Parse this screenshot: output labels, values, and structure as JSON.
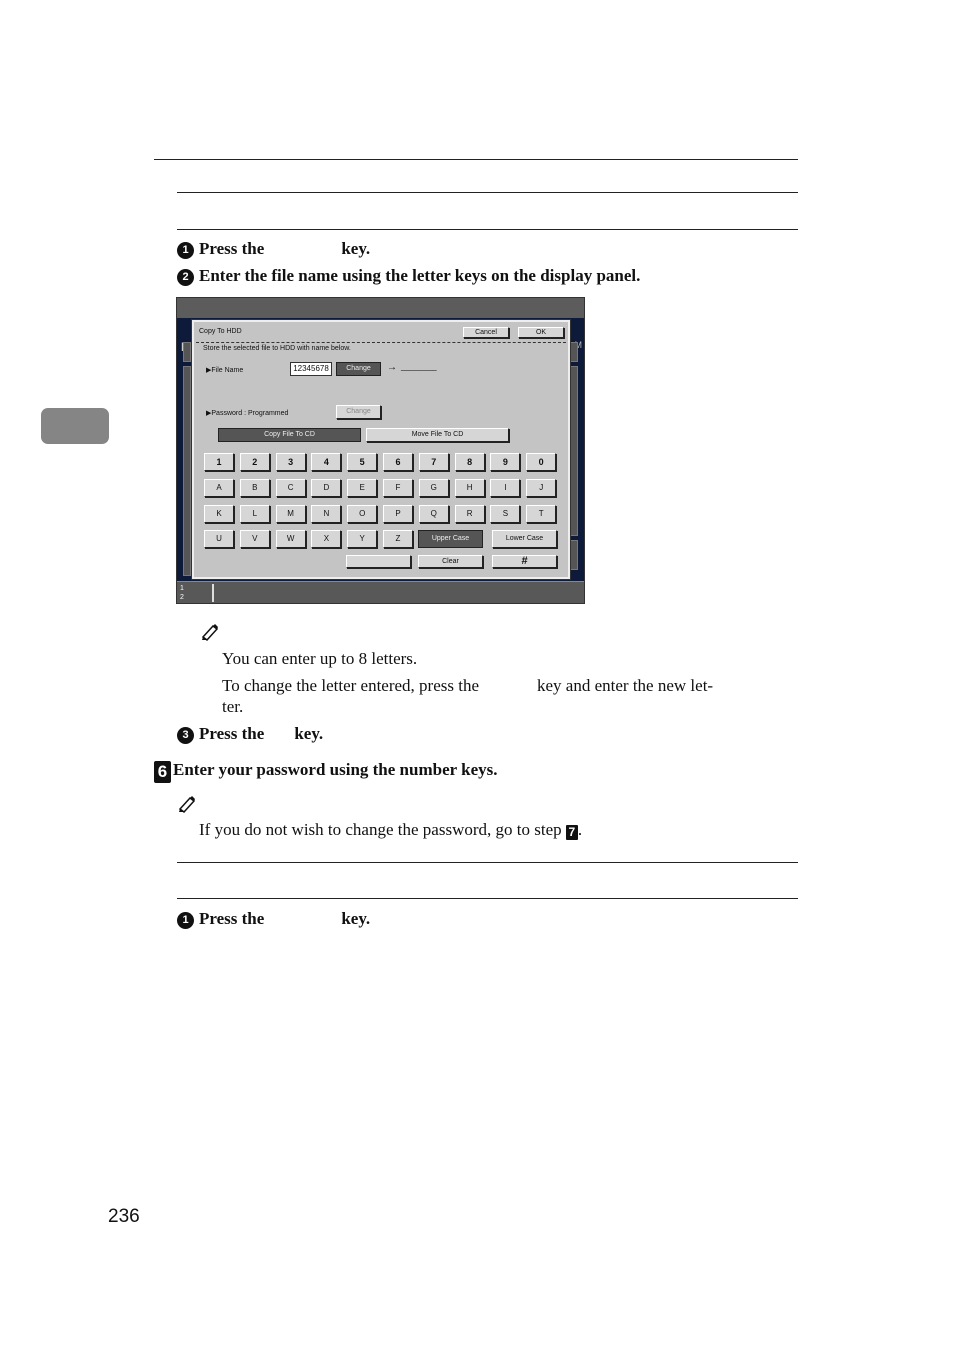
{
  "steps_top": {
    "step1": {
      "num": "1",
      "text_before": "Press the",
      "text_after": "key."
    },
    "step2": {
      "num": "2",
      "text": "Enter the file name using the letter keys on the display panel."
    }
  },
  "screen": {
    "bg_letter": "D",
    "bg_right_label": "M",
    "tray": {
      "line1": "1",
      "line2": "2"
    },
    "dialog": {
      "title": "Copy To HDD",
      "cancel_label": "Cancel",
      "ok_label": "OK",
      "description": "Store the selected file to HDD with name below.",
      "file_name_label": "▶File Name",
      "file_name_value": "12345678",
      "change_label": "Change",
      "arrow": "→",
      "new_name": "________",
      "password_label": "▶Password : Programmed",
      "password_change_label": "Change",
      "copy_to_cd_label": "Copy File To CD",
      "move_to_cd_label": "Move File To CD",
      "number_keys": [
        "1",
        "2",
        "3",
        "4",
        "5",
        "6",
        "7",
        "8",
        "9",
        "0"
      ],
      "letter_row1": [
        "A",
        "B",
        "C",
        "D",
        "E",
        "F",
        "G",
        "H",
        "I",
        "J"
      ],
      "letter_row2": [
        "K",
        "L",
        "M",
        "N",
        "O",
        "P",
        "Q",
        "R",
        "S",
        "T"
      ],
      "letter_row3": [
        "U",
        "V",
        "W",
        "X",
        "Y",
        "Z"
      ],
      "upper_case_label": "Upper Case",
      "lower_case_label": "Lower Case",
      "space_label": "",
      "clear_label": "Clear",
      "hash_label": "#"
    }
  },
  "note1": {
    "line1": "You can enter up to 8 letters.",
    "line2_before": "To change the letter entered, press the",
    "line2_after": "key and enter the new let-",
    "line3": "ter."
  },
  "step3": {
    "num": "3",
    "text_before": "Press the",
    "text_after": "key."
  },
  "step6": {
    "num": "6",
    "text": "Enter your password using the number keys."
  },
  "note2": {
    "text_before": "If you do not wish to change the password, go to step",
    "step_ref": "7",
    "text_after": "."
  },
  "steps_bottom": {
    "step1": {
      "num": "1",
      "text_before": "Press the",
      "text_after": "key."
    }
  },
  "page_number": "236"
}
